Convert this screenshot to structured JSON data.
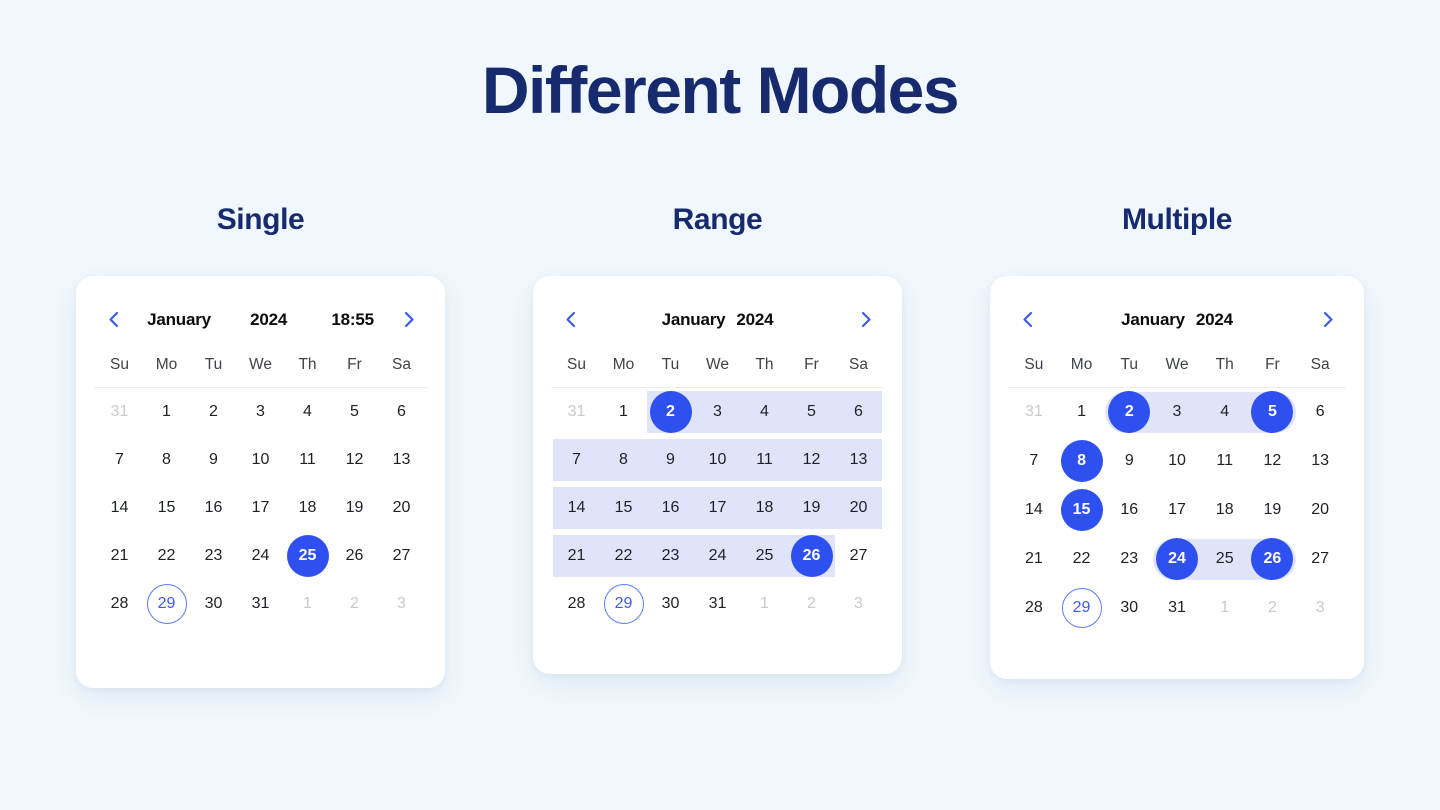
{
  "page": {
    "title": "Different Modes",
    "background_color": "#f0f8fd",
    "title_color": "#172a6e",
    "accent_color": "#2f50f0",
    "range_band_color": "#dfe4fb",
    "card_color": "#ffffff"
  },
  "icons": {
    "prev": "chevron-left-icon",
    "next": "chevron-right-icon"
  },
  "weekdays": [
    "Su",
    "Mo",
    "Tu",
    "We",
    "Th",
    "Fr",
    "Sa"
  ],
  "calendars": [
    {
      "mode": "single",
      "section_label": "Single",
      "header": {
        "month": "January",
        "year": "2024",
        "time": "18:55",
        "show_time": true,
        "prev_label": "Previous month",
        "next_label": "Next month"
      },
      "weeks": [
        [
          {
            "n": "31",
            "state": "outside"
          },
          {
            "n": "1",
            "state": "normal"
          },
          {
            "n": "2",
            "state": "normal"
          },
          {
            "n": "3",
            "state": "normal"
          },
          {
            "n": "4",
            "state": "normal"
          },
          {
            "n": "5",
            "state": "normal"
          },
          {
            "n": "6",
            "state": "normal"
          }
        ],
        [
          {
            "n": "7",
            "state": "normal"
          },
          {
            "n": "8",
            "state": "normal"
          },
          {
            "n": "9",
            "state": "normal"
          },
          {
            "n": "10",
            "state": "normal"
          },
          {
            "n": "11",
            "state": "normal"
          },
          {
            "n": "12",
            "state": "normal"
          },
          {
            "n": "13",
            "state": "normal"
          }
        ],
        [
          {
            "n": "14",
            "state": "normal"
          },
          {
            "n": "15",
            "state": "normal"
          },
          {
            "n": "16",
            "state": "normal"
          },
          {
            "n": "17",
            "state": "normal"
          },
          {
            "n": "18",
            "state": "normal"
          },
          {
            "n": "19",
            "state": "normal"
          },
          {
            "n": "20",
            "state": "normal"
          }
        ],
        [
          {
            "n": "21",
            "state": "normal"
          },
          {
            "n": "22",
            "state": "normal"
          },
          {
            "n": "23",
            "state": "normal"
          },
          {
            "n": "24",
            "state": "normal"
          },
          {
            "n": "25",
            "state": "selected"
          },
          {
            "n": "26",
            "state": "normal"
          },
          {
            "n": "27",
            "state": "normal"
          }
        ],
        [
          {
            "n": "28",
            "state": "normal"
          },
          {
            "n": "29",
            "state": "today"
          },
          {
            "n": "30",
            "state": "normal"
          },
          {
            "n": "31",
            "state": "normal"
          },
          {
            "n": "1",
            "state": "outside"
          },
          {
            "n": "2",
            "state": "outside"
          },
          {
            "n": "3",
            "state": "outside"
          }
        ]
      ],
      "bands": []
    },
    {
      "mode": "range",
      "section_label": "Range",
      "header": {
        "month": "January",
        "year": "2024",
        "time": "",
        "show_time": false,
        "prev_label": "Previous month",
        "next_label": "Next month"
      },
      "weeks": [
        [
          {
            "n": "31",
            "state": "outside"
          },
          {
            "n": "1",
            "state": "normal"
          },
          {
            "n": "2",
            "state": "selected"
          },
          {
            "n": "3",
            "state": "normal"
          },
          {
            "n": "4",
            "state": "normal"
          },
          {
            "n": "5",
            "state": "normal"
          },
          {
            "n": "6",
            "state": "normal"
          }
        ],
        [
          {
            "n": "7",
            "state": "normal"
          },
          {
            "n": "8",
            "state": "normal"
          },
          {
            "n": "9",
            "state": "normal"
          },
          {
            "n": "10",
            "state": "normal"
          },
          {
            "n": "11",
            "state": "normal"
          },
          {
            "n": "12",
            "state": "normal"
          },
          {
            "n": "13",
            "state": "normal"
          }
        ],
        [
          {
            "n": "14",
            "state": "normal"
          },
          {
            "n": "15",
            "state": "normal"
          },
          {
            "n": "16",
            "state": "normal"
          },
          {
            "n": "17",
            "state": "normal"
          },
          {
            "n": "18",
            "state": "normal"
          },
          {
            "n": "19",
            "state": "normal"
          },
          {
            "n": "20",
            "state": "normal"
          }
        ],
        [
          {
            "n": "21",
            "state": "normal"
          },
          {
            "n": "22",
            "state": "normal"
          },
          {
            "n": "23",
            "state": "normal"
          },
          {
            "n": "24",
            "state": "normal"
          },
          {
            "n": "25",
            "state": "normal"
          },
          {
            "n": "26",
            "state": "selected"
          },
          {
            "n": "27",
            "state": "normal"
          }
        ],
        [
          {
            "n": "28",
            "state": "normal"
          },
          {
            "n": "29",
            "state": "today"
          },
          {
            "n": "30",
            "state": "normal"
          },
          {
            "n": "31",
            "state": "normal"
          },
          {
            "n": "1",
            "state": "outside"
          },
          {
            "n": "2",
            "state": "outside"
          },
          {
            "n": "3",
            "state": "outside"
          }
        ]
      ],
      "range_start": "2",
      "range_end": "26",
      "bands": [
        {
          "week": 0,
          "from": 2,
          "to": 6,
          "shape": "square"
        },
        {
          "week": 1,
          "from": 0,
          "to": 6,
          "shape": "square"
        },
        {
          "week": 2,
          "from": 0,
          "to": 6,
          "shape": "square"
        },
        {
          "week": 3,
          "from": 0,
          "to": 5,
          "shape": "square"
        }
      ]
    },
    {
      "mode": "multiple",
      "section_label": "Multiple",
      "header": {
        "month": "January",
        "year": "2024",
        "time": "",
        "show_time": false,
        "prev_label": "Previous month",
        "next_label": "Next month"
      },
      "weeks": [
        [
          {
            "n": "31",
            "state": "outside"
          },
          {
            "n": "1",
            "state": "normal"
          },
          {
            "n": "2",
            "state": "selected"
          },
          {
            "n": "3",
            "state": "normal"
          },
          {
            "n": "4",
            "state": "normal"
          },
          {
            "n": "5",
            "state": "selected"
          },
          {
            "n": "6",
            "state": "normal"
          }
        ],
        [
          {
            "n": "7",
            "state": "normal"
          },
          {
            "n": "8",
            "state": "selected"
          },
          {
            "n": "9",
            "state": "normal"
          },
          {
            "n": "10",
            "state": "normal"
          },
          {
            "n": "11",
            "state": "normal"
          },
          {
            "n": "12",
            "state": "normal"
          },
          {
            "n": "13",
            "state": "normal"
          }
        ],
        [
          {
            "n": "14",
            "state": "normal"
          },
          {
            "n": "15",
            "state": "selected"
          },
          {
            "n": "16",
            "state": "normal"
          },
          {
            "n": "17",
            "state": "normal"
          },
          {
            "n": "18",
            "state": "normal"
          },
          {
            "n": "19",
            "state": "normal"
          },
          {
            "n": "20",
            "state": "normal"
          }
        ],
        [
          {
            "n": "21",
            "state": "normal"
          },
          {
            "n": "22",
            "state": "normal"
          },
          {
            "n": "23",
            "state": "normal"
          },
          {
            "n": "24",
            "state": "selected"
          },
          {
            "n": "25",
            "state": "normal"
          },
          {
            "n": "26",
            "state": "selected"
          },
          {
            "n": "27",
            "state": "normal"
          }
        ],
        [
          {
            "n": "28",
            "state": "normal"
          },
          {
            "n": "29",
            "state": "today"
          },
          {
            "n": "30",
            "state": "normal"
          },
          {
            "n": "31",
            "state": "normal"
          },
          {
            "n": "1",
            "state": "outside"
          },
          {
            "n": "2",
            "state": "outside"
          },
          {
            "n": "3",
            "state": "outside"
          }
        ]
      ],
      "selected_days": [
        "2",
        "5",
        "8",
        "15",
        "24",
        "26"
      ],
      "bands": [
        {
          "week": 0,
          "from": 2,
          "to": 5,
          "shape": "pill"
        },
        {
          "week": 3,
          "from": 3,
          "to": 5,
          "shape": "pill"
        }
      ]
    }
  ]
}
